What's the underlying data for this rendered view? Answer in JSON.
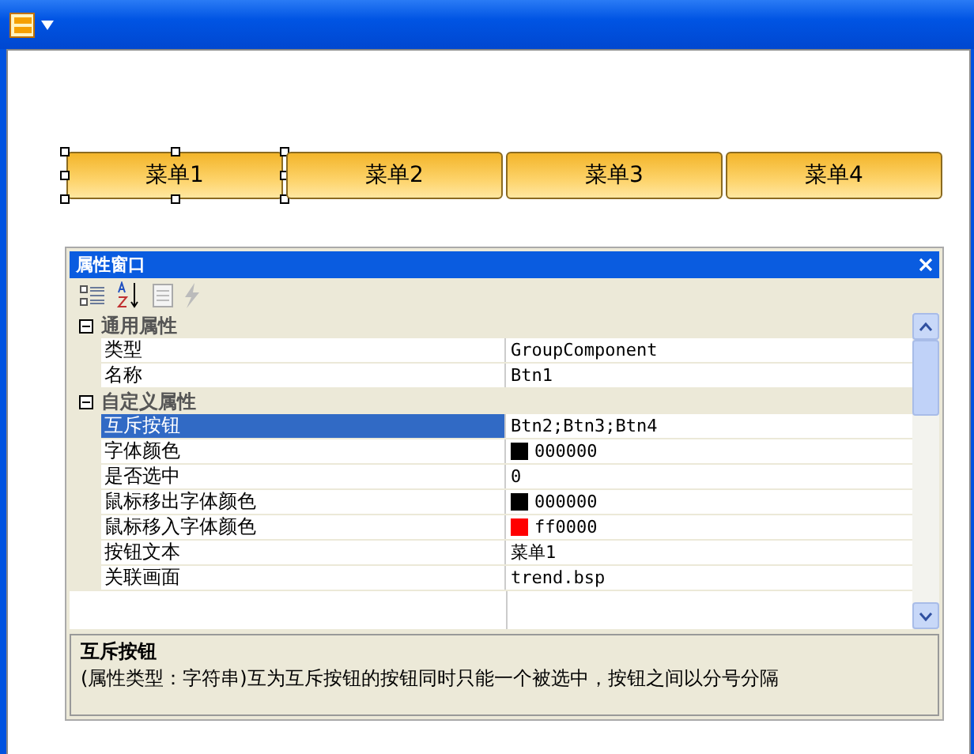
{
  "menu_buttons": [
    {
      "label": "菜单1",
      "selected": true
    },
    {
      "label": "菜单2",
      "selected": false
    },
    {
      "label": "菜单3",
      "selected": false
    },
    {
      "label": "菜单4",
      "selected": false
    }
  ],
  "property_window": {
    "title": "属性窗口",
    "groups": [
      {
        "name": "通用属性",
        "expanded": true,
        "rows": [
          {
            "label": "类型",
            "value": "GroupComponent",
            "selected": false
          },
          {
            "label": "名称",
            "value": "Btn1",
            "selected": false
          }
        ]
      },
      {
        "name": "自定义属性",
        "expanded": true,
        "rows": [
          {
            "label": "互斥按钮",
            "value": "Btn2;Btn3;Btn4",
            "selected": true
          },
          {
            "label": "字体颜色",
            "value": "000000",
            "color": "#000000",
            "selected": false
          },
          {
            "label": "是否选中",
            "value": "0",
            "selected": false
          },
          {
            "label": "鼠标移出字体颜色",
            "value": "000000",
            "color": "#000000",
            "selected": false
          },
          {
            "label": "鼠标移入字体颜色",
            "value": "ff0000",
            "color": "#ff0000",
            "selected": false
          },
          {
            "label": "按钮文本",
            "value": "菜单1",
            "selected": false
          },
          {
            "label": "关联画面",
            "value": "trend.bsp",
            "selected": false
          }
        ]
      }
    ],
    "description": {
      "title": "互斥按钮",
      "text": "(属性类型：字符串)互为互斥按钮的按钮同时只能一个被选中，按钮之间以分号分隔"
    }
  }
}
